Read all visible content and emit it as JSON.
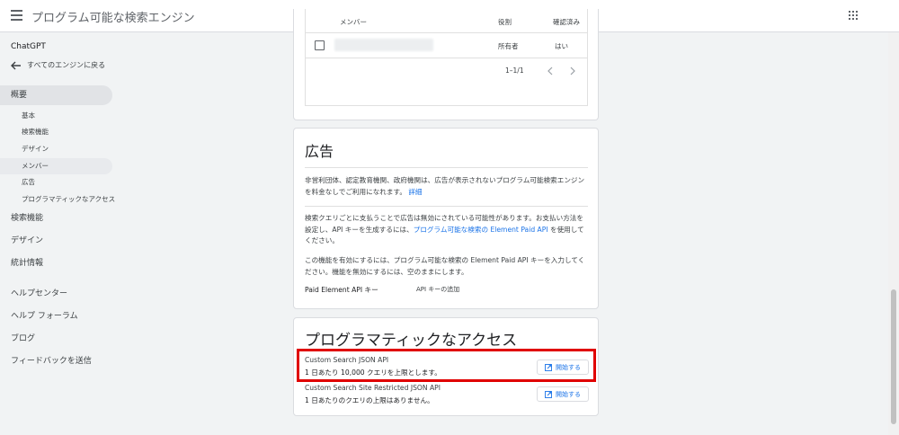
{
  "header": {
    "title": "プログラム可能な検索エンジン"
  },
  "sidebar": {
    "brand": "ChatGPT",
    "back_link": "すべてのエンジンに戻る",
    "items": [
      {
        "label": "概要"
      },
      {
        "label": "基本"
      },
      {
        "label": "検索機能"
      },
      {
        "label": "デザイン"
      },
      {
        "label": "メンバー"
      },
      {
        "label": "広告"
      },
      {
        "label": "プログラマティックなアクセス"
      },
      {
        "label": "検索機能"
      },
      {
        "label": "デザイン"
      },
      {
        "label": "統計情報"
      },
      {
        "label": "ヘルプセンター"
      },
      {
        "label": "ヘルプ フォーラム"
      },
      {
        "label": "ブログ"
      },
      {
        "label": "フィードバックを送信"
      }
    ]
  },
  "members": {
    "columns": [
      "メンバー",
      "役割",
      "確認済み"
    ],
    "row": {
      "role": "所有者",
      "confirmed": "はい"
    },
    "pagination": "1–1/1"
  },
  "ads": {
    "title": "広告",
    "p1": "非営利団体、認定教育機関、政府機関は、広告が表示されないプログラム可能検索エンジンを料金なしでご利用になれます。",
    "p1_link": "詳細",
    "p2": "検索クエリごとに支払うことで広告は無効にされている可能性があります。お支払い方法を設定し、API キーを生成するには、",
    "p2_link": "プログラム可能な検索の Element Paid API",
    "p2_end": " を使用してください。",
    "p3": "この機能を有効にするには、プログラム可能な検索の Element Paid API キーを入力してください。機能を無効にするには、空のままにします。",
    "key_label": "Paid Element API キー",
    "key_value": "API キーの追加"
  },
  "access": {
    "title": "プログラマティックなアクセス",
    "apis": [
      {
        "name": "Custom Search JSON API",
        "desc": "1 日あたり 10,000 クエリを上限とします。",
        "button": "開始する"
      },
      {
        "name": "Custom Search Site Restricted JSON API",
        "desc": "1 日あたりのクエリの上限はありません。",
        "button": "開始する"
      }
    ]
  },
  "colors": {
    "accent": "#1a73e8",
    "highlight": "#e00000",
    "background": "#f1f3f4"
  }
}
